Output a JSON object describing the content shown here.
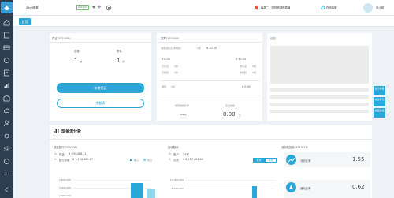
{
  "colors": {
    "sidebar": "#2c3e50",
    "accent": "#2aa7d6",
    "green": "#6cc06c",
    "bar_light": "#8fd6ef"
  },
  "topbar": {
    "company": "演示账套",
    "period": "2020-08",
    "notice": "每周二、四财税课程直播",
    "online_service": "在线客服",
    "user": "张小强"
  },
  "tabs": [
    {
      "label": "首页"
    }
  ],
  "voucher": {
    "title": "凭证(2020/08)",
    "total_label": "总数",
    "total_value": "1",
    "total_unit": "张",
    "draft_label": "附件",
    "draft_value": "1",
    "draft_unit": "张",
    "new_button": "新增凭证",
    "balance_button": "余额表"
  },
  "invoice": {
    "title": "发票(2020/08)",
    "input_label": "进项(含认证未抵扣)",
    "input_count": "0张",
    "input_amount": "¥ 30.33",
    "amount_left": "¥ 0.00",
    "amount_right": "¥ 30.33",
    "certified": "已认证",
    "certified_count": "0张",
    "uncertified": "未认证",
    "uncertified_count": "0张",
    "deducted": "已抵扣",
    "deducted_count": "0张",
    "undeducted": "未抵扣",
    "undeducted_count": "0张",
    "output_label": "销项",
    "output_count": "0张",
    "output_amount": "¥ 0.00",
    "tax_label": "增值税税负率",
    "tax_value": "---",
    "payable_label": "应交税额",
    "payable_value": "0.00",
    "payable_unit": "元"
  },
  "dynamic": {
    "title": "动态"
  },
  "float_buttons": [
    {
      "label": "设计模板"
    },
    {
      "label": "关注有礼"
    },
    {
      "label": "桌面快捷"
    }
  ],
  "cashflow": {
    "section_title": "现金流分析",
    "cash_title": "现金银行(2020/08)",
    "cash_label": "现金",
    "cash_value": "¥ 490,468.11",
    "bank_label": "银行存款",
    "bank_value": "¥ 1,296,800.87",
    "legend_in": "收入",
    "legend_out": "支出",
    "y_ticks": [
      "3,500,000",
      "3,000,000",
      "2,500,000"
    ],
    "ar_title": "应收账款",
    "customer_label": "客户",
    "customer_value": "24家",
    "ar_amount_label": "欠款",
    "ar_amount_value": "¥ 8,157,401.49",
    "toggle_month": "按月",
    "toggle_year": "按年",
    "ar_ticks": [
      "10,000,000",
      "8,000,000"
    ],
    "ratio_title": "流动性指标(2019/12)",
    "ratio1_label": "流动比率",
    "ratio1_value": "1.55",
    "ratio2_label": "速动比率",
    "ratio2_value": "0.62"
  }
}
